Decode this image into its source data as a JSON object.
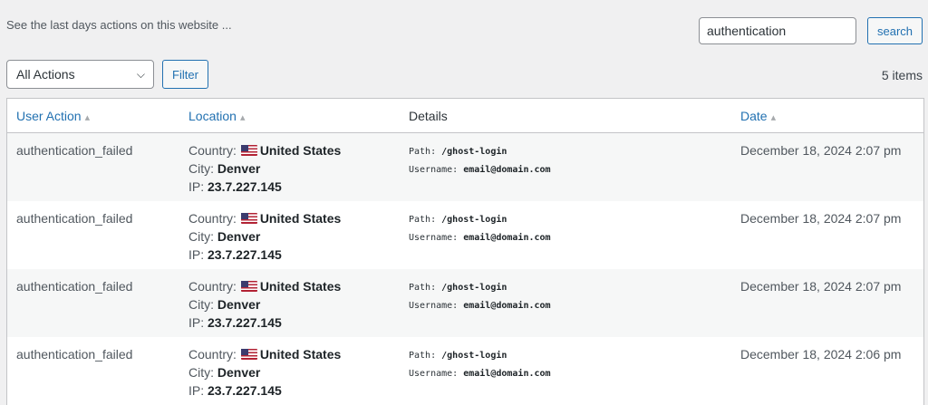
{
  "intro_text": "See the last days actions on this website ...",
  "search": {
    "value": "authentication",
    "button_label": "search"
  },
  "filter": {
    "selected": "All Actions",
    "button_label": "Filter"
  },
  "items_count": "5 items",
  "columns": [
    "User Action",
    "Location",
    "Details",
    "Date"
  ],
  "labels": {
    "country": "Country:",
    "city": "City:",
    "ip": "IP:",
    "path": "Path:",
    "username": "Username:"
  },
  "rows": [
    {
      "action": "authentication_failed",
      "country": "United States",
      "city": "Denver",
      "ip": "23.7.227.145",
      "path": "/ghost-login",
      "username": "email@domain.com",
      "date": "December 18, 2024 2:07 pm"
    },
    {
      "action": "authentication_failed",
      "country": "United States",
      "city": "Denver",
      "ip": "23.7.227.145",
      "path": "/ghost-login",
      "username": "email@domain.com",
      "date": "December 18, 2024 2:07 pm"
    },
    {
      "action": "authentication_failed",
      "country": "United States",
      "city": "Denver",
      "ip": "23.7.227.145",
      "path": "/ghost-login",
      "username": "email@domain.com",
      "date": "December 18, 2024 2:07 pm"
    },
    {
      "action": "authentication_failed",
      "country": "United States",
      "city": "Denver",
      "ip": "23.7.227.145",
      "path": "/ghost-login",
      "username": "email@domain.com",
      "date": "December 18, 2024 2:06 pm"
    }
  ],
  "colors": {
    "accent": "#2271b1",
    "row_alt": "#f6f7f7",
    "border": "#c3c4c7"
  }
}
